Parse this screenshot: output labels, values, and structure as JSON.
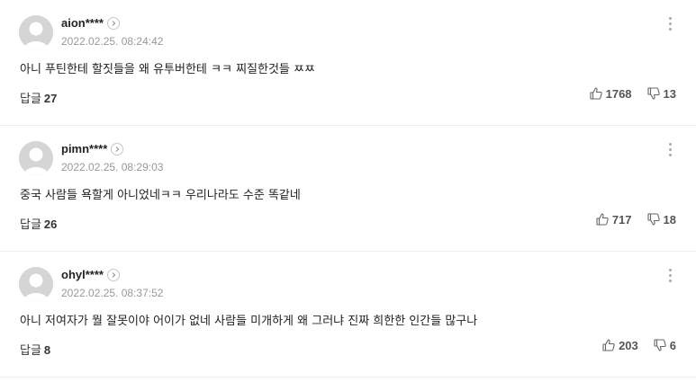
{
  "comments": [
    {
      "nickname": "aion****",
      "date": "2022.02.25. 08:24:42",
      "text": "아니 푸틴한테 할짓들을 왜 유투버한테 ㅋㅋ 찌질한것들 ㅉㅉ",
      "reply_label": "답글",
      "reply_count": "27",
      "likes": "1768",
      "dislikes": "13"
    },
    {
      "nickname": "pimn****",
      "date": "2022.02.25. 08:29:03",
      "text": "중국 사람들 욕할게 아니었네ㅋㅋ 우리나라도 수준 똑같네",
      "reply_label": "답글",
      "reply_count": "26",
      "likes": "717",
      "dislikes": "18"
    },
    {
      "nickname": "ohyl****",
      "date": "2022.02.25. 08:37:52",
      "text": "아니 저여자가 뭘 잘못이야 어이가 없네 사람들 미개하게 왜 그러냐 진짜 희한한 인간들 많구나",
      "reply_label": "답글",
      "reply_count": "8",
      "likes": "203",
      "dislikes": "6"
    }
  ]
}
